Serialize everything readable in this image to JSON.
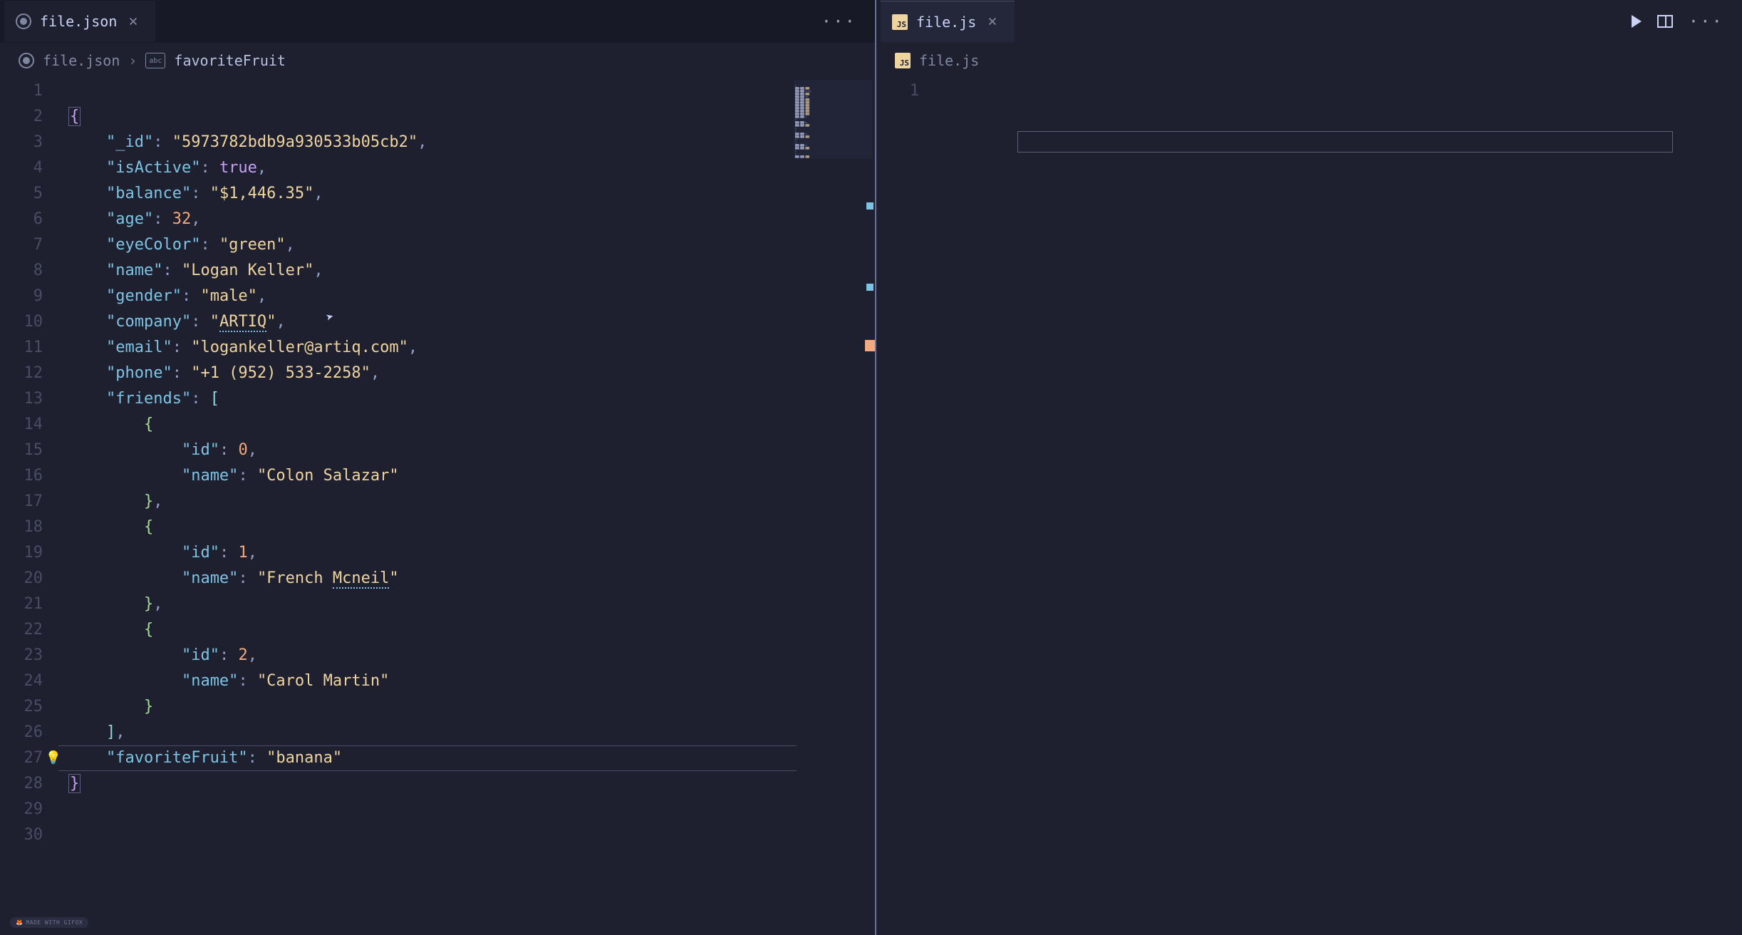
{
  "left_pane": {
    "tab": {
      "filename": "file.json",
      "close": "×"
    },
    "ellipsis": "···",
    "breadcrumb": {
      "file": "file.json",
      "separator": "›",
      "symbol_icon": "abc",
      "symbol": "favoriteFruit"
    },
    "line_count": 30,
    "highlighted_line": 27,
    "bulb_line": 27,
    "json_content": {
      "_id": "5973782bdb9a930533b05cb2",
      "isActive": true,
      "balance": "$1,446.35",
      "age": 32,
      "eyeColor": "green",
      "name": "Logan Keller",
      "gender": "male",
      "company": "ARTIQ",
      "email": "logankeller@artiq.com",
      "phone": "+1 (952) 533-2258",
      "friends": [
        {
          "id": 0,
          "name": "Colon Salazar"
        },
        {
          "id": 1,
          "name": "French Mcneil"
        },
        {
          "id": 2,
          "name": "Carol Martin"
        }
      ],
      "favoriteFruit": "banana"
    },
    "squiggles": [
      "ARTIQ",
      "Mcneil"
    ],
    "overview_markers": [
      {
        "pos_pct": 14.5,
        "color": "blue"
      },
      {
        "pos_pct": 24.0,
        "color": "blue"
      },
      {
        "pos_pct": 30.5,
        "color": "orange"
      }
    ]
  },
  "right_pane": {
    "tab": {
      "filename": "file.js",
      "close": "×"
    },
    "actions": {
      "run": "▶",
      "split": "⫿",
      "more": "···"
    },
    "breadcrumb": {
      "file": "file.js"
    },
    "line_count": 1,
    "content": ""
  },
  "watermark": "MADE WITH GIFOX",
  "colors": {
    "bg": "#1e2030",
    "key": "#7dc4e4",
    "string": "#eed49f",
    "number": "#f5a97f",
    "bool": "#c6a0f6"
  }
}
